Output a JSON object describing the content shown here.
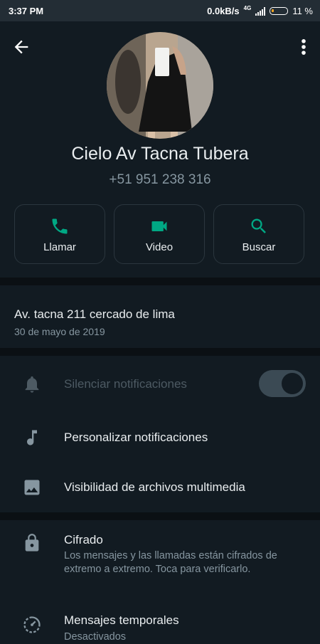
{
  "status_bar": {
    "time": "3:37 PM",
    "network_speed": "0.0kB/s",
    "network_type": "4G",
    "battery": "11 %"
  },
  "contact": {
    "name": "Cielo Av Tacna Tubera",
    "phone": "+51 951 238 316"
  },
  "actions": [
    {
      "label": "Llamar",
      "icon": "phone-icon"
    },
    {
      "label": "Video",
      "icon": "videocam-icon"
    },
    {
      "label": "Buscar",
      "icon": "search-icon"
    }
  ],
  "about": {
    "text": "Av. tacna 211 cercado de lima",
    "date": "30 de mayo de 2019"
  },
  "settings": {
    "mute": {
      "label": "Silenciar notificaciones",
      "enabled": false,
      "icon": "bell-icon"
    },
    "custom_notifications": {
      "label": "Personalizar notificaciones",
      "icon": "music-note-icon"
    },
    "media_visibility": {
      "label": "Visibilidad de archivos multimedia",
      "icon": "image-icon"
    }
  },
  "encryption": {
    "label": "Cifrado",
    "description": "Los mensajes y las llamadas están cifrados de extremo a extremo. Toca para verificarlo.",
    "icon": "lock-icon"
  },
  "disappearing": {
    "label": "Mensajes temporales",
    "value": "Desactivados",
    "icon": "timer-icon"
  },
  "colors": {
    "accent": "#00a884",
    "background": "#121b22",
    "separator": "#0b1014",
    "secondary_text": "#8696a0"
  }
}
